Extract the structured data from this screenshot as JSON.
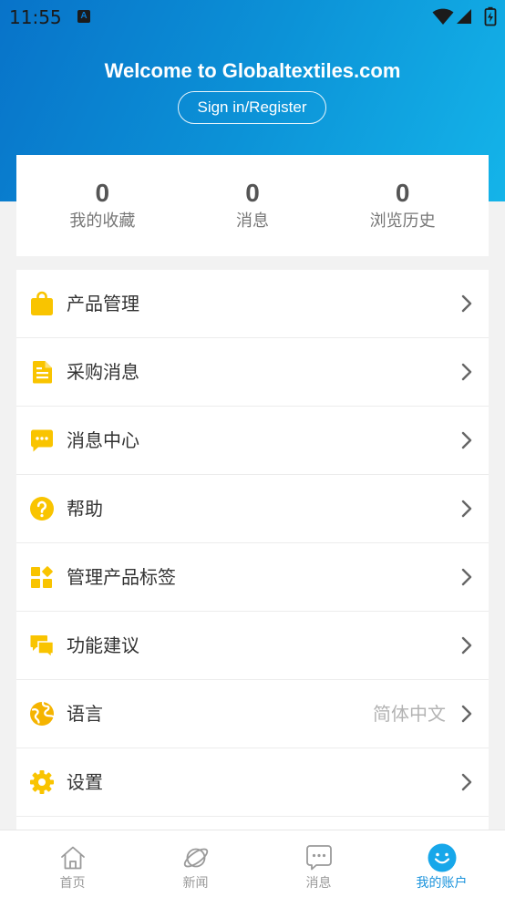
{
  "status_bar": {
    "time": "11:55",
    "notification_badge": "A",
    "icons": [
      "a-notification-icon",
      "wifi-icon",
      "cell-signal-icon",
      "battery-charging-icon"
    ]
  },
  "header": {
    "title": "Welcome to Globaltextiles.com",
    "auth_button_label": "Sign in/Register"
  },
  "stats": [
    {
      "value": "0",
      "label": "我的收藏"
    },
    {
      "value": "0",
      "label": "消息"
    },
    {
      "value": "0",
      "label": "浏览历史"
    }
  ],
  "menu": [
    {
      "label": "产品管理",
      "icon": "shopping-bag-icon"
    },
    {
      "label": "采购消息",
      "icon": "document-icon"
    },
    {
      "label": "消息中心",
      "icon": "chat-bubble-icon"
    },
    {
      "label": "帮助",
      "icon": "help-circle-icon"
    },
    {
      "label": "管理产品标签",
      "icon": "tags-grid-icon"
    },
    {
      "label": "功能建议",
      "icon": "feedback-bubbles-icon"
    },
    {
      "label": "语言",
      "icon": "globe-icon",
      "value": "简体中文"
    },
    {
      "label": "设置",
      "icon": "gear-icon"
    }
  ],
  "tab_bar": {
    "items": [
      {
        "label": "首页",
        "icon": "home-icon",
        "active": false
      },
      {
        "label": "新闻",
        "icon": "planet-icon",
        "active": false
      },
      {
        "label": "消息",
        "icon": "chat-icon",
        "active": false
      },
      {
        "label": "我的账户",
        "icon": "smiley-icon",
        "active": true
      }
    ]
  },
  "colors": {
    "header_gradient_start": "#0873c9",
    "header_gradient_end": "#14b4e9",
    "icon_yellow": "#f9c400",
    "active_tab": "#1a93dc",
    "inactive_tab": "#9a9a9a",
    "background": "#f2f2f2"
  }
}
